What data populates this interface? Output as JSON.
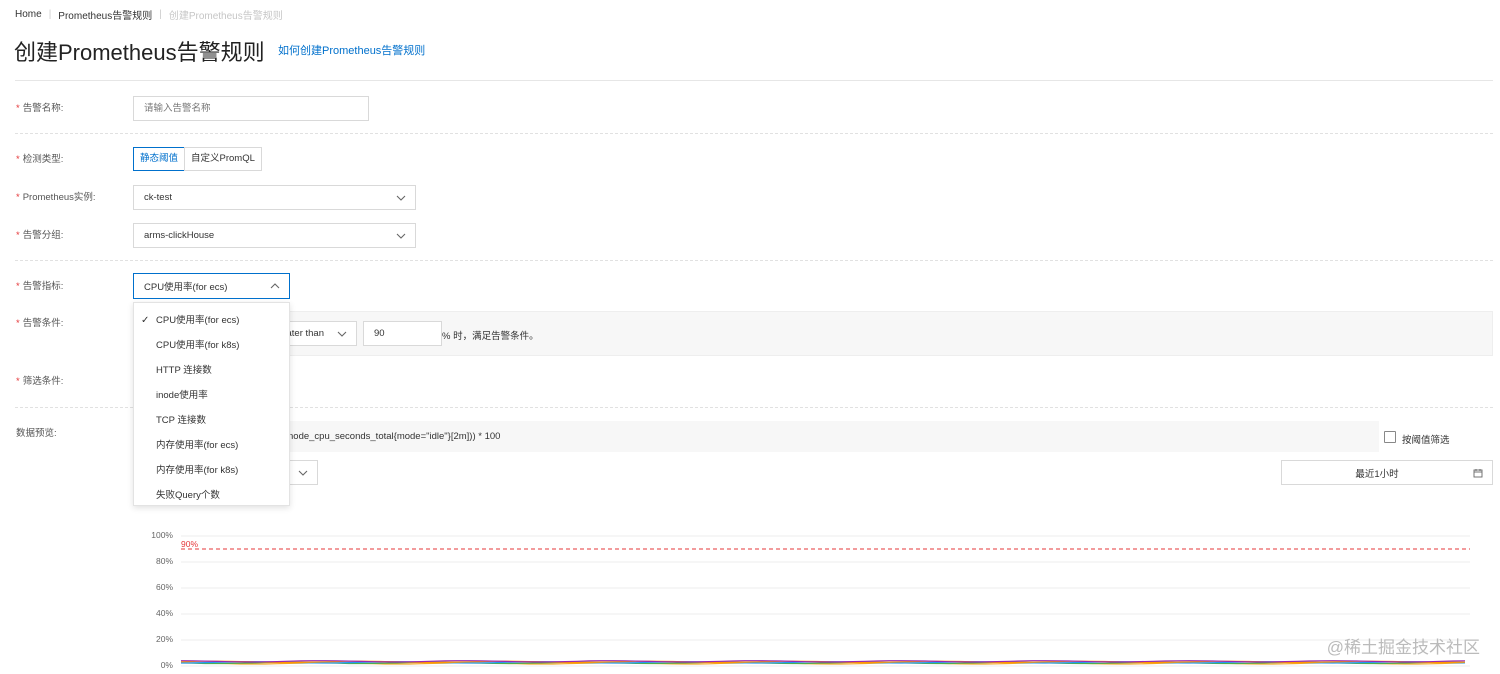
{
  "breadcrumb": {
    "home": "Home",
    "rules": "Prometheus告警规则",
    "current": "创建Prometheus告警规则"
  },
  "page": {
    "title": "创建Prometheus告警规则",
    "help_link": "如何创建Prometheus告警规则"
  },
  "form": {
    "alert_name": {
      "label": "告警名称:",
      "placeholder": "请输入告警名称",
      "value": ""
    },
    "detect_type": {
      "label": "检测类型:",
      "options": [
        "静态阈值",
        "自定义PromQL"
      ],
      "selected": "静态阈值"
    },
    "instance": {
      "label": "Prometheus实例:",
      "value": "ck-test"
    },
    "group": {
      "label": "告警分组:",
      "value": "arms-clickHouse"
    },
    "metric": {
      "label": "告警指标:",
      "value": "CPU使用率(for ecs)"
    },
    "condition": {
      "label": "告警条件:",
      "operator_text": "ater than",
      "threshold": "90",
      "suffix": "% 时，满足告警条件。"
    },
    "filter": {
      "label": "筛选条件:"
    }
  },
  "metric_dropdown": {
    "selected": "CPU使用率(for ecs)",
    "options": [
      "CPU使用率(for ecs)",
      "CPU使用率(for k8s)",
      "HTTP 连接数",
      "inode使用率",
      "TCP 连接数",
      "内存使用率(for ecs)",
      "内存使用率(for k8s)",
      "失败Query个数"
    ]
  },
  "preview": {
    "label": "数据预览:",
    "query": "node_cpu_seconds_total{mode=\"idle\"}[2m])) * 100",
    "threshold_filter_label": "按阈值筛选",
    "time_range": "最近1小时"
  },
  "chart_data": {
    "type": "line",
    "y_ticks": [
      "100%",
      "80%",
      "60%",
      "40%",
      "20%",
      "0%"
    ],
    "ylim": [
      0,
      100
    ],
    "threshold": {
      "value": 90,
      "label": "90%"
    },
    "series_colors": [
      "#f5a623",
      "#4caf50",
      "#2196f3",
      "#ff9800",
      "#9c27b0"
    ]
  },
  "watermark": "@稀土掘金技术社区",
  "colors": {
    "accent": "#0070cc",
    "required": "#e5373a",
    "threshold": "#e5373a"
  }
}
